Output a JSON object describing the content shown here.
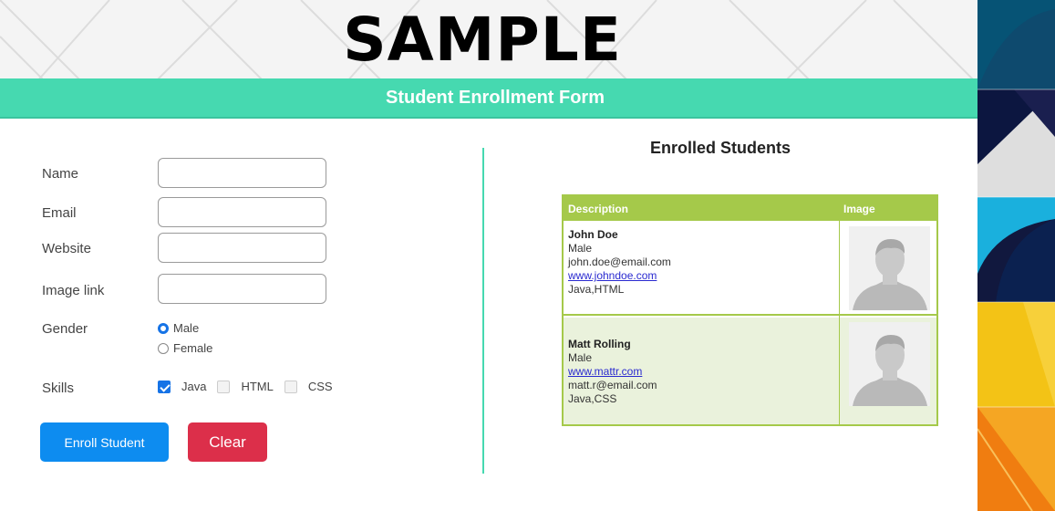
{
  "watermark": "SAMPLE",
  "header": {
    "title": "Student Enrollment Form"
  },
  "form": {
    "name_label": "Name",
    "email_label": "Email",
    "website_label": "Website",
    "image_link_label": "Image link",
    "gender_label": "Gender",
    "gender_options": [
      "Male",
      "Female"
    ],
    "gender_selected": "Male",
    "skills_label": "Skills",
    "skills": [
      {
        "label": "Java",
        "checked": true
      },
      {
        "label": "HTML",
        "checked": false
      },
      {
        "label": "CSS",
        "checked": false
      }
    ],
    "name_value": "",
    "email_value": "",
    "website_value": "",
    "image_link_value": "",
    "enroll_button": "Enroll Student",
    "clear_button": "Clear"
  },
  "enrolled": {
    "title": "Enrolled Students",
    "columns": [
      "Description",
      "Image"
    ],
    "students": [
      {
        "name": "John Doe",
        "gender": "Male",
        "line3": "john.doe@email.com",
        "line4": "www.johndoe.com",
        "skills": "Java,HTML"
      },
      {
        "name": "Matt Rolling",
        "gender": "Male",
        "line3": "www.mattr.com",
        "line4": "matt.r@email.com",
        "skills": "Java,CSS"
      }
    ]
  },
  "colors": {
    "header": "#46d9b0",
    "table_accent": "#a5c94a",
    "enroll": "#0d8cf0",
    "clear": "#dc2f4a"
  }
}
